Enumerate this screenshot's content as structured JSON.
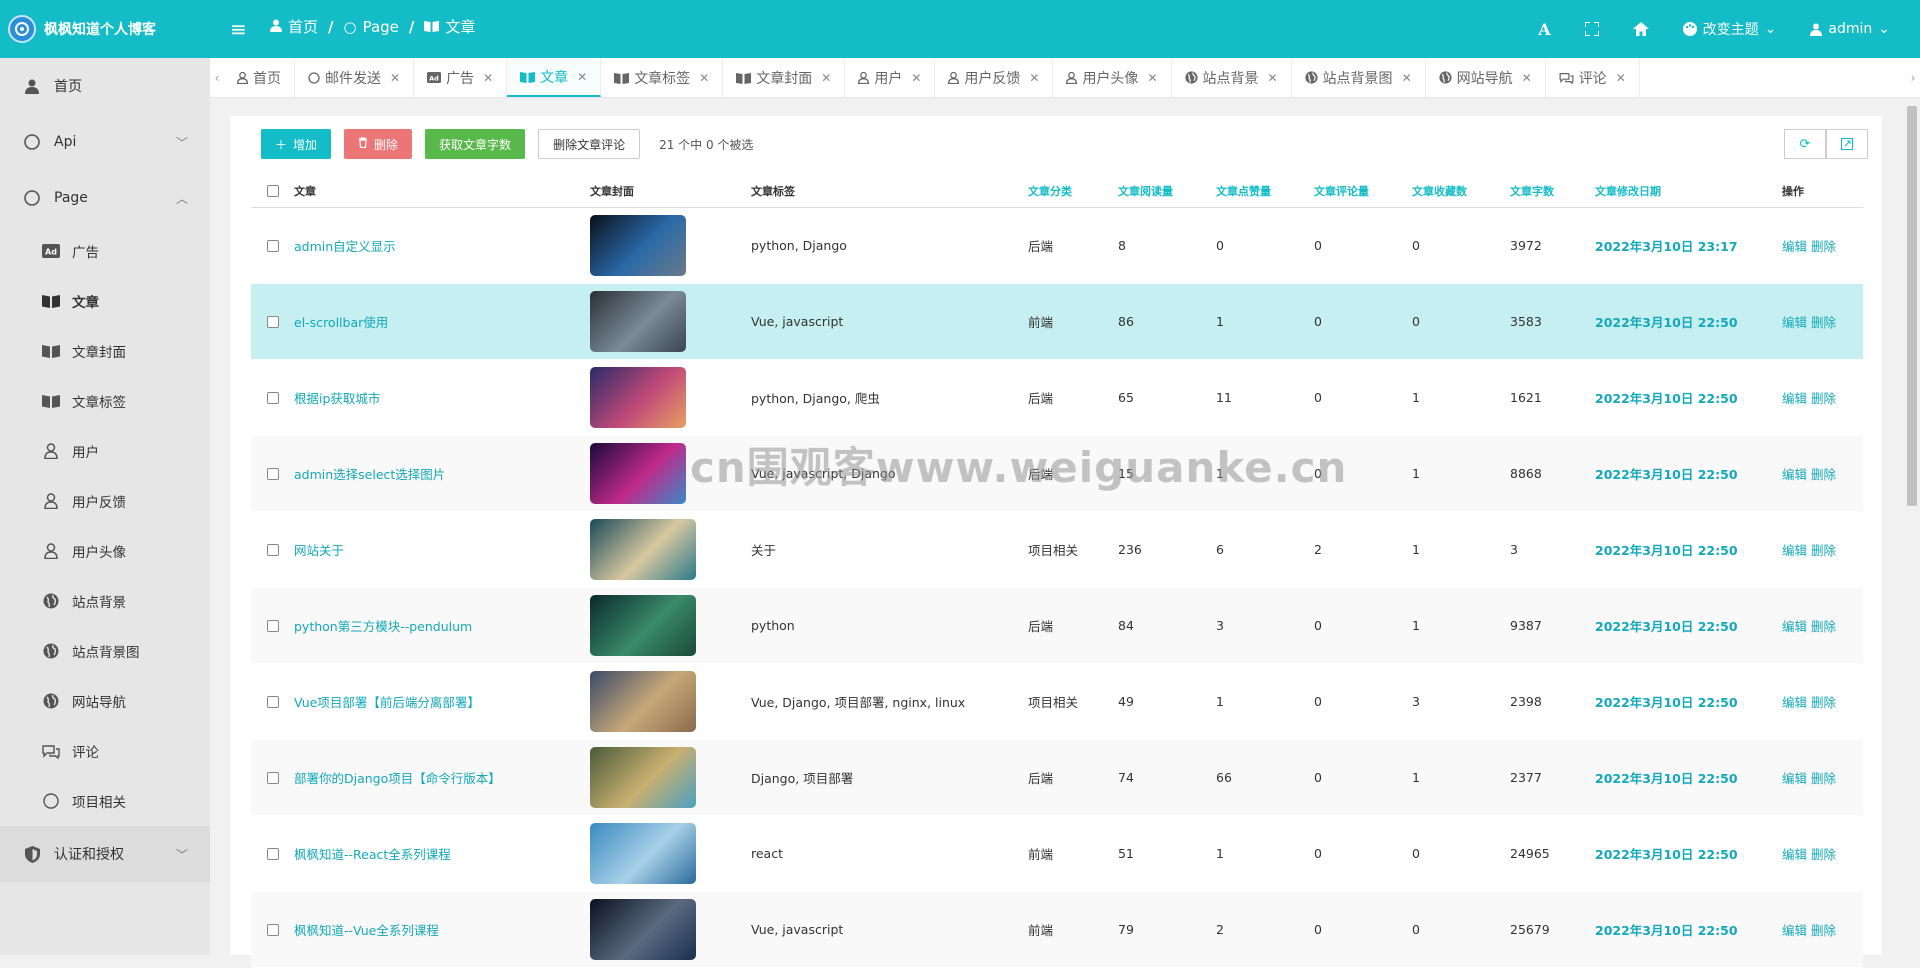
{
  "header": {
    "site_title": "枫枫知道个人博客",
    "breadcrumbs": [
      "首页",
      "Page",
      "文章"
    ],
    "theme_label": "改变主题",
    "user": "admin"
  },
  "sidebar": {
    "items": [
      {
        "label": "首页",
        "icon": "user-icon"
      },
      {
        "label": "Api",
        "icon": "circle-icon"
      },
      {
        "label": "Page",
        "icon": "circle-icon"
      }
    ],
    "sub_items": [
      {
        "label": "广告",
        "icon": "ad-icon"
      },
      {
        "label": "文章",
        "icon": "book-icon"
      },
      {
        "label": "文章封面",
        "icon": "book-icon"
      },
      {
        "label": "文章标签",
        "icon": "book-icon"
      },
      {
        "label": "用户",
        "icon": "user-icon"
      },
      {
        "label": "用户反馈",
        "icon": "user-icon"
      },
      {
        "label": "用户头像",
        "icon": "user-icon"
      },
      {
        "label": "站点背景",
        "icon": "globe-icon"
      },
      {
        "label": "站点背景图",
        "icon": "globe-icon"
      },
      {
        "label": "网站导航",
        "icon": "globe-icon"
      },
      {
        "label": "评论",
        "icon": "comment-icon"
      },
      {
        "label": "项目相关",
        "icon": "circle-icon"
      }
    ],
    "auth_item": {
      "label": "认证和授权",
      "icon": "shield-icon"
    }
  },
  "tabs": [
    {
      "label": "首页",
      "icon": "user-icon"
    },
    {
      "label": "邮件发送",
      "icon": "circle-icon"
    },
    {
      "label": "广告",
      "icon": "ad-icon"
    },
    {
      "label": "文章",
      "icon": "book-icon"
    },
    {
      "label": "文章标签",
      "icon": "book-icon"
    },
    {
      "label": "文章封面",
      "icon": "book-icon"
    },
    {
      "label": "用户",
      "icon": "user-icon"
    },
    {
      "label": "用户反馈",
      "icon": "user-icon"
    },
    {
      "label": "用户头像",
      "icon": "user-icon"
    },
    {
      "label": "站点背景",
      "icon": "globe-icon"
    },
    {
      "label": "站点背景图",
      "icon": "globe-icon"
    },
    {
      "label": "网站导航",
      "icon": "globe-icon"
    },
    {
      "label": "评论",
      "icon": "comment-icon"
    }
  ],
  "toolbar": {
    "add_label": "增加",
    "delete_label": "删除",
    "count_label": "获取文章字数",
    "delete_comments_label": "删除文章评论",
    "selection_info": "21 个中 0 个被选"
  },
  "table": {
    "headers": [
      "文章",
      "文章封面",
      "文章标签",
      "文章分类",
      "文章阅读量",
      "文章点赞量",
      "文章评论量",
      "文章收藏数",
      "文章字数",
      "文章修改日期",
      "操作"
    ],
    "edit_label": "编辑",
    "delete_label": "删除",
    "rows": [
      {
        "title": "admin自定义显示",
        "tags": "python, Django",
        "category": "后端",
        "reads": "8",
        "likes": "0",
        "comments": "0",
        "collects": "0",
        "words": "3972",
        "date": "2022年3月10日 23:17",
        "thumb": [
          "#0a0f1c",
          "#2a6aa8",
          "#6a7a8a"
        ]
      },
      {
        "title": "el-scrollbar使用",
        "tags": "Vue, javascript",
        "category": "前端",
        "reads": "86",
        "likes": "1",
        "comments": "0",
        "collects": "0",
        "words": "3583",
        "date": "2022年3月10日 22:50",
        "thumb": [
          "#2a3038",
          "#7a8a96",
          "#3a4652"
        ]
      },
      {
        "title": "根据ip获取城市",
        "tags": "python, Django, 爬虫",
        "category": "后端",
        "reads": "65",
        "likes": "11",
        "comments": "0",
        "collects": "1",
        "words": "1621",
        "date": "2022年3月10日 22:50",
        "thumb": [
          "#2a2a6a",
          "#c04a7a",
          "#e8a060"
        ]
      },
      {
        "title": "admin选择select选择图片",
        "tags": "Vue, javascript, Django",
        "category": "后端",
        "reads": "15",
        "likes": "1",
        "comments": "0",
        "collects": "1",
        "words": "8868",
        "date": "2022年3月10日 22:50",
        "thumb": [
          "#1a0a3a",
          "#c02a8a",
          "#3a8ac8"
        ]
      },
      {
        "title": "网站关于",
        "tags": "关于",
        "category": "项目相关",
        "reads": "236",
        "likes": "6",
        "comments": "2",
        "collects": "1",
        "words": "3",
        "date": "2022年3月10日 22:50",
        "thumb": [
          "#1a4a5a",
          "#d8c8a0",
          "#2a7a8a"
        ]
      },
      {
        "title": "python第三方模块--pendulum",
        "tags": "python",
        "category": "后端",
        "reads": "84",
        "likes": "3",
        "comments": "0",
        "collects": "1",
        "words": "9387",
        "date": "2022年3月10日 22:50",
        "thumb": [
          "#0a2a2a",
          "#3a8a6a",
          "#1a4a3a"
        ]
      },
      {
        "title": "Vue项目部署【前后端分离部署】",
        "tags": "Vue, Django, 项目部署, nginx, linux",
        "category": "项目相关",
        "reads": "49",
        "likes": "1",
        "comments": "0",
        "collects": "3",
        "words": "2398",
        "date": "2022年3月10日 22:50",
        "thumb": [
          "#3a4a6a",
          "#c8a878",
          "#8a6a4a"
        ]
      },
      {
        "title": "部署你的Django项目【命令行版本】",
        "tags": "Django, 项目部署",
        "category": "后端",
        "reads": "74",
        "likes": "66",
        "comments": "0",
        "collects": "1",
        "words": "2377",
        "date": "2022年3月10日 22:50",
        "thumb": [
          "#4a5a3a",
          "#c8b070",
          "#4aa0c0"
        ]
      },
      {
        "title": "枫枫知道--React全系列课程",
        "tags": "react",
        "category": "前端",
        "reads": "51",
        "likes": "1",
        "comments": "0",
        "collects": "0",
        "words": "24965",
        "date": "2022年3月10日 22:50",
        "thumb": [
          "#3a8ac0",
          "#a8d0e8",
          "#2a6a9a"
        ]
      },
      {
        "title": "枫枫知道--Vue全系列课程",
        "tags": "Vue, javascript",
        "category": "前端",
        "reads": "79",
        "likes": "2",
        "comments": "0",
        "collects": "0",
        "words": "25679",
        "date": "2022年3月10日 22:50",
        "thumb": [
          "#0a1020",
          "#5a6a80",
          "#1a3050"
        ]
      }
    ]
  },
  "watermark": "cn围观客www.weiguanke.cn"
}
